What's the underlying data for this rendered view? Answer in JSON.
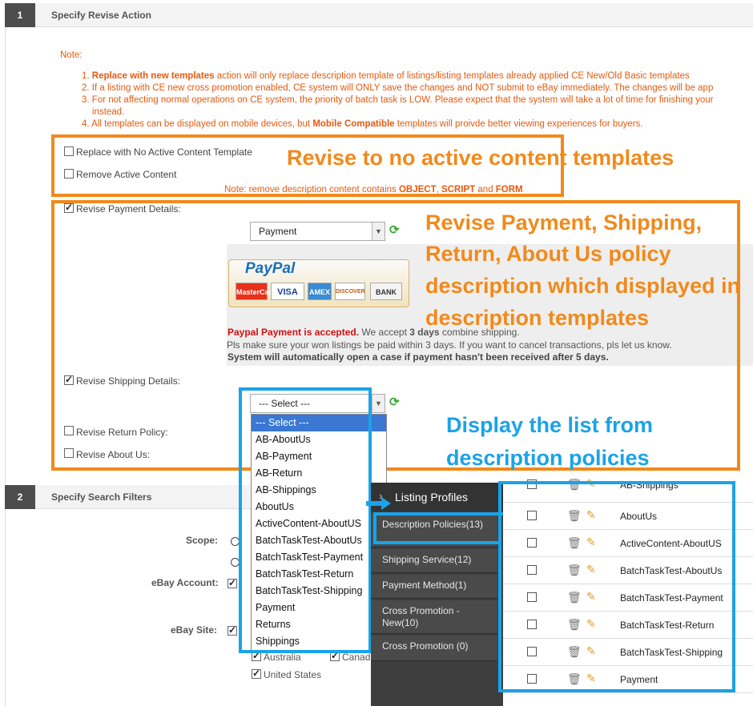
{
  "section1": {
    "number": "1",
    "title": "Specify Revise Action"
  },
  "notes": {
    "heading": "Note:",
    "items": [
      {
        "bold": "Replace with new templates",
        "text": " action will only replace description template of listings/listing templates already applied CE New/Old Basic templates",
        "prefix": "1."
      },
      {
        "prefix": "2.",
        "text": "If a listing with CE new cross promotion enabled, CE system will ONLY save the changes and NOT submit to eBay immediately. The changes will be app"
      },
      {
        "prefix": "3.",
        "text": "For not affecting normal operations on CE system, the priority of batch task is LOW. Please expect that the system will take a lot of time for finishing your",
        "cont": "instead."
      },
      {
        "prefix": "4.",
        "text": "All templates can be displayed on mobile devices, but ",
        "bold": "Mobile Compatible",
        "text2": " templates will proivde better viewing experiences for buyers."
      }
    ]
  },
  "options": {
    "replace_no_active": "Replace with No Active Content Template",
    "remove_active": "Remove Active Content",
    "remove_note_prefix": "Note: remove description content contains ",
    "remove_note_obj": "OBJECT",
    "remove_note_script": "SCRIPT",
    "remove_note_and": " and ",
    "remove_note_form": "FORM",
    "revise_payment": "Revise Payment Details:",
    "revise_shipping": "Revise Shipping Details:",
    "revise_return": "Revise Return Policy:",
    "revise_about": "Revise About Us:"
  },
  "payment_select": {
    "value": "Payment"
  },
  "shipping_select": {
    "value": "--- Select ---"
  },
  "paypal": {
    "logo_text": "PayPal",
    "cards": [
      "MasterCard",
      "VISA",
      "AMEX",
      "DISCOVER",
      "BANK"
    ],
    "accepted": "Paypal Payment is accepted.",
    "accepted_rest_1": " We accept ",
    "days": "3 days",
    "accepted_rest_2": " combine shipping.",
    "line2": "Pls make sure your won listings be paid within 3 days. If you want to cancel transactions, pls let us know.",
    "line3": "System  will automatically open a case if payment hasn't been received after 5 days."
  },
  "dropdown_options": [
    "--- Select ---",
    "AB-AboutUs",
    "AB-Payment",
    "AB-Return",
    "AB-Shippings",
    "AboutUs",
    "ActiveContent-AboutUS",
    "BatchTaskTest-AboutUs",
    "BatchTaskTest-Payment",
    "BatchTaskTest-Return",
    "BatchTaskTest-Shipping",
    "Payment",
    "Returns",
    "Shippings"
  ],
  "section2": {
    "number": "2",
    "title": "Specify Search Filters"
  },
  "filters": {
    "scope": "Scope:",
    "ebay_account": "eBay Account:",
    "ebay_site": "eBay Site:",
    "site_australia": "Australia",
    "site_canada": "Canad",
    "site_us": "United States"
  },
  "annotations": {
    "a1": "Revise to no active content templates",
    "a2_l1": "Revise Payment, Shipping,",
    "a2_l2": "Return, About Us policy",
    "a2_l3": "description which displayed in",
    "a2_l4": "description templates",
    "a3_l1": "Display the list from",
    "a3_l2": "description policies"
  },
  "listing_profiles": {
    "title": "Listing Profiles",
    "items": [
      {
        "label": "Description Policies(13)"
      },
      {
        "label": "Shipping Service(12)"
      },
      {
        "label": "Payment Method(1)"
      },
      {
        "label": "Cross Promotion - New(10)"
      },
      {
        "label": "Cross Promotion (0)"
      }
    ]
  },
  "policy_list": [
    "AB-Shippings",
    "AboutUs",
    "ActiveContent-AboutUS",
    "BatchTaskTest-AboutUs",
    "BatchTaskTest-Payment",
    "BatchTaskTest-Return",
    "BatchTaskTest-Shipping",
    "Payment"
  ],
  "colors": {
    "orange": "#f08a1c",
    "blue": "#1aa3e8",
    "note": "#e8590c",
    "red": "#d01010"
  }
}
